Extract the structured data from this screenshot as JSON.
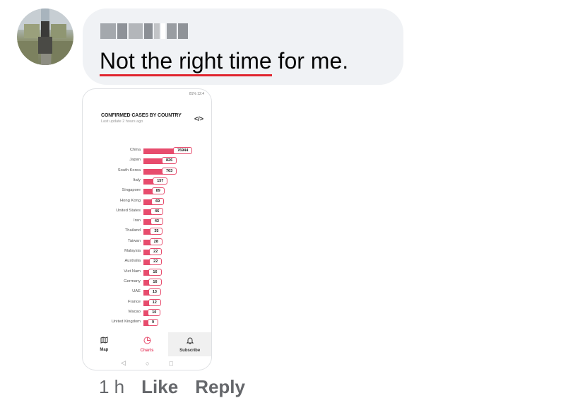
{
  "comment": {
    "author_blurred": "",
    "text_underlined": "Not the right time",
    "text_rest": " for me.",
    "time": "1 h",
    "like_label": "Like",
    "reply_label": "Reply"
  },
  "attachment": {
    "status_left": "",
    "status_right": "81% 12:4",
    "title": "CONFIRMED CASES BY COUNTRY",
    "subtitle": "Last update 2 hours ago",
    "embed_icon": "</>",
    "tabs": [
      {
        "label": "Map",
        "icon": "map-icon"
      },
      {
        "label": "Charts",
        "icon": "chart-icon"
      },
      {
        "label": "Subscribe",
        "icon": "bell-icon"
      }
    ],
    "nav_icons": [
      "back-icon",
      "home-icon",
      "recent-icon"
    ]
  },
  "colors": {
    "bar": "#e74c6d",
    "underline": "#e0242e",
    "bubble": "#f0f2f5",
    "meta": "#65676b"
  },
  "chart_data": {
    "type": "bar",
    "title": "CONFIRMED CASES BY COUNTRY",
    "subtitle": "Last update 2 hours ago",
    "categories": [
      "China",
      "Japan",
      "South Korea",
      "Italy",
      "Singapore",
      "Hong Kong",
      "United States",
      "Iran",
      "Thailand",
      "Taiwan",
      "Malaysia",
      "Australia",
      "Viet Nam",
      "Germany",
      "UAE",
      "France",
      "Macao",
      "United Kingdom"
    ],
    "values": [
      76944,
      826,
      763,
      157,
      89,
      69,
      46,
      43,
      35,
      28,
      22,
      22,
      16,
      16,
      13,
      12,
      10,
      9
    ],
    "orientation": "horizontal"
  }
}
